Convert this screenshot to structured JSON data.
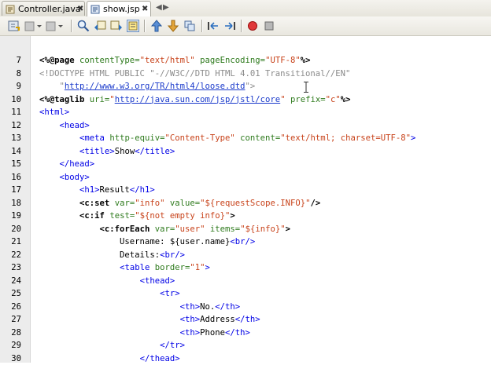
{
  "tabs": [
    {
      "label": "Controller.java",
      "icon": "java-file-icon",
      "active": false
    },
    {
      "label": "show.jsp",
      "icon": "jsp-file-icon",
      "active": true
    }
  ],
  "toolbar": {
    "buttons": [
      "back-source-icon",
      "back-history-icon",
      "forward-history-icon",
      "find-icon",
      "find-previous-icon",
      "find-next-icon",
      "toggle-highlight-icon",
      "previous-bookmark-icon",
      "next-bookmark-icon",
      "toggle-bookmark-icon",
      "shift-left-icon",
      "shift-right-icon",
      "start-macro-icon",
      "stop-macro-icon"
    ]
  },
  "editor": {
    "lines": [
      {
        "n": "7",
        "tokens": [
          [
            "t-jsp",
            "<%@"
          ],
          [
            "t-jsp",
            "page "
          ],
          [
            "t-attr",
            "contentType="
          ],
          [
            "t-str",
            "\"text/html\""
          ],
          [
            "t-text",
            " "
          ],
          [
            "t-attr",
            "pageEncoding="
          ],
          [
            "t-str",
            "\"UTF-8\""
          ],
          [
            "t-jsp",
            "%>"
          ]
        ]
      },
      {
        "n": "8",
        "tokens": [
          [
            "t-comment",
            "<!DOCTYPE HTML PUBLIC \"-//W3C//DTD HTML 4.01 Transitional//EN\""
          ]
        ]
      },
      {
        "n": "9",
        "tokens": [
          [
            "t-comment",
            "    \""
          ],
          [
            "t-url",
            "http://www.w3.org/TR/html4/loose.dtd"
          ],
          [
            "t-comment",
            "\">"
          ]
        ]
      },
      {
        "n": "10",
        "tokens": [
          [
            "t-jsp",
            "<%@"
          ],
          [
            "t-jsp",
            "taglib "
          ],
          [
            "t-attr",
            "uri="
          ],
          [
            "t-str",
            "\""
          ],
          [
            "t-url",
            "http://java.sun.com/jsp/jstl/core"
          ],
          [
            "t-str",
            "\""
          ],
          [
            "t-text",
            " "
          ],
          [
            "t-attr",
            "prefix="
          ],
          [
            "t-str",
            "\"c\""
          ],
          [
            "t-jsp",
            "%>"
          ]
        ]
      },
      {
        "n": "11",
        "tokens": [
          [
            "t-tag",
            "<html>"
          ]
        ]
      },
      {
        "n": "12",
        "tokens": [
          [
            "t-text",
            "    "
          ],
          [
            "t-tag",
            "<head>"
          ]
        ]
      },
      {
        "n": "13",
        "tokens": [
          [
            "t-text",
            "        "
          ],
          [
            "t-tag",
            "<meta "
          ],
          [
            "t-attr",
            "http-equiv="
          ],
          [
            "t-str",
            "\"Content-Type\""
          ],
          [
            "t-text",
            " "
          ],
          [
            "t-attr",
            "content="
          ],
          [
            "t-str",
            "\"text/html; charset=UTF-8\""
          ],
          [
            "t-tag",
            ">"
          ]
        ]
      },
      {
        "n": "14",
        "tokens": [
          [
            "t-text",
            "        "
          ],
          [
            "t-tag",
            "<title>"
          ],
          [
            "t-text",
            "Show"
          ],
          [
            "t-tag",
            "</title>"
          ]
        ]
      },
      {
        "n": "15",
        "tokens": [
          [
            "t-text",
            "    "
          ],
          [
            "t-tag",
            "</head>"
          ]
        ]
      },
      {
        "n": "16",
        "tokens": [
          [
            "t-text",
            "    "
          ],
          [
            "t-tag",
            "<body>"
          ]
        ]
      },
      {
        "n": "17",
        "tokens": [
          [
            "t-text",
            "        "
          ],
          [
            "t-tag",
            "<h1>"
          ],
          [
            "t-text",
            "Result"
          ],
          [
            "t-tag",
            "</h1>"
          ]
        ]
      },
      {
        "n": "18",
        "tokens": [
          [
            "t-text",
            "        "
          ],
          [
            "t-jsp",
            "<c:set "
          ],
          [
            "t-attr",
            "var="
          ],
          [
            "t-str",
            "\"info\""
          ],
          [
            "t-text",
            " "
          ],
          [
            "t-attr",
            "value="
          ],
          [
            "t-str",
            "\"${requestScope.INFO}\""
          ],
          [
            "t-jsp",
            "/>"
          ]
        ]
      },
      {
        "n": "19",
        "tokens": [
          [
            "t-text",
            "        "
          ],
          [
            "t-jsp",
            "<c:if "
          ],
          [
            "t-attr",
            "test="
          ],
          [
            "t-str",
            "\"${not empty info}\""
          ],
          [
            "t-jsp",
            ">"
          ]
        ]
      },
      {
        "n": "20",
        "tokens": [
          [
            "t-text",
            "            "
          ],
          [
            "t-jsp",
            "<c:forEach "
          ],
          [
            "t-attr",
            "var="
          ],
          [
            "t-str",
            "\"user\""
          ],
          [
            "t-text",
            " "
          ],
          [
            "t-attr",
            "items="
          ],
          [
            "t-str",
            "\"${info}\""
          ],
          [
            "t-jsp",
            ">"
          ]
        ]
      },
      {
        "n": "21",
        "tokens": [
          [
            "t-text",
            "                Username: ${user.name}"
          ],
          [
            "t-tag",
            "<br/>"
          ]
        ]
      },
      {
        "n": "22",
        "tokens": [
          [
            "t-text",
            "                Details:"
          ],
          [
            "t-tag",
            "<br/>"
          ]
        ]
      },
      {
        "n": "23",
        "tokens": [
          [
            "t-text",
            "                "
          ],
          [
            "t-tag",
            "<table "
          ],
          [
            "t-attr",
            "border="
          ],
          [
            "t-str",
            "\"1\""
          ],
          [
            "t-tag",
            ">"
          ]
        ]
      },
      {
        "n": "24",
        "tokens": [
          [
            "t-text",
            "                    "
          ],
          [
            "t-tag",
            "<thead>"
          ]
        ]
      },
      {
        "n": "25",
        "tokens": [
          [
            "t-text",
            "                        "
          ],
          [
            "t-tag",
            "<tr>"
          ]
        ]
      },
      {
        "n": "26",
        "tokens": [
          [
            "t-text",
            "                            "
          ],
          [
            "t-tag",
            "<th>"
          ],
          [
            "t-text",
            "No."
          ],
          [
            "t-tag",
            "</th>"
          ]
        ]
      },
      {
        "n": "27",
        "tokens": [
          [
            "t-text",
            "                            "
          ],
          [
            "t-tag",
            "<th>"
          ],
          [
            "t-text",
            "Address"
          ],
          [
            "t-tag",
            "</th>"
          ]
        ]
      },
      {
        "n": "28",
        "tokens": [
          [
            "t-text",
            "                            "
          ],
          [
            "t-tag",
            "<th>"
          ],
          [
            "t-text",
            "Phone"
          ],
          [
            "t-tag",
            "</th>"
          ]
        ]
      },
      {
        "n": "29",
        "tokens": [
          [
            "t-text",
            "                        "
          ],
          [
            "t-tag",
            "</tr>"
          ]
        ]
      },
      {
        "n": "30",
        "tokens": [
          [
            "t-text",
            "                    "
          ],
          [
            "t-tag",
            "</thead>"
          ]
        ]
      }
    ]
  },
  "colors": {
    "keyword_tag": "#0000e6",
    "attribute": "#2f7b1e",
    "string": "#c8431b",
    "comment": "#8a8a8a",
    "gutter": "#ececec"
  }
}
